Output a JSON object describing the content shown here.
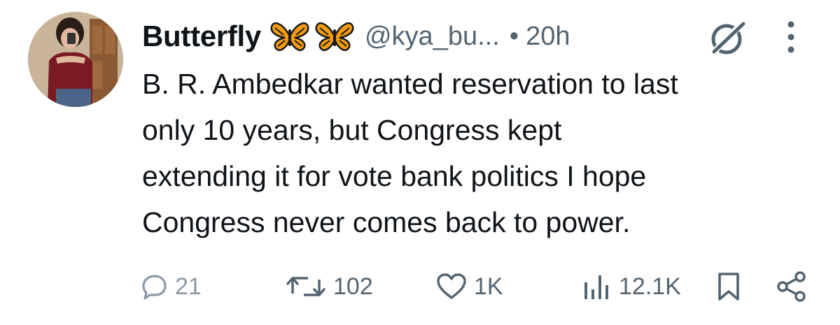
{
  "author": {
    "display_name": "Butterfly",
    "name_emojis": [
      "butterfly-icon",
      "butterfly-icon"
    ],
    "handle": "@kya_bu...",
    "separator": "•",
    "timestamp": "20h"
  },
  "tweet": {
    "text": "B. R. Ambedkar wanted reservation to last\nonly 10 years, but Congress kept\nextending it for vote bank politics I hope\nCongress never comes back to power."
  },
  "actions": {
    "replies": "21",
    "retweets": "102",
    "likes": "1K",
    "views": "12.1K"
  },
  "colors": {
    "text": "#0f1419",
    "secondary": "#536471",
    "butterfly_orange": "#f39c12"
  }
}
